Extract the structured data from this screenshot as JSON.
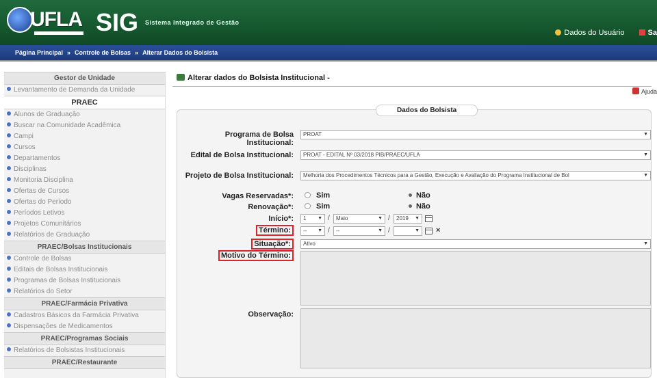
{
  "header": {
    "logo_text": "UFLA",
    "app_name": "SIG",
    "app_subtitle": "Sistema Integrado de Gestão",
    "user_link": "Dados do Usuário",
    "exit_link": "Sa"
  },
  "breadcrumb": [
    "Página Principal",
    "»",
    "Controle de Bolsas",
    "»",
    "Alterar Dados do Bolsista"
  ],
  "sidebar": {
    "sections": [
      {
        "title": "Gestor de Unidade",
        "big": false,
        "items": [
          "Levantamento de Demanda da Unidade"
        ]
      },
      {
        "title": "PRAEC",
        "big": true,
        "items": [
          "Alunos de Graduação",
          "Buscar na Comunidade Acadêmica",
          "Campi",
          "Cursos",
          "Departamentos",
          "Disciplinas",
          "Monitoria Disciplina",
          "Ofertas de Cursos",
          "Ofertas do Período",
          "Períodos Letivos",
          "Projetos Comunitários",
          "Relatórios de Graduação"
        ]
      },
      {
        "title": "PRAEC/Bolsas Institucionais",
        "big": false,
        "items": [
          "Controle de Bolsas",
          "Editais de Bolsas Institucionais",
          "Programas de Bolsas Institucionais",
          "Relatórios do Setor"
        ]
      },
      {
        "title": "PRAEC/Farmácia Privativa",
        "big": false,
        "items": [
          "Cadastros Básicos da Farmácia Privativa",
          "Dispensações de Medicamentos"
        ]
      },
      {
        "title": "PRAEC/Programas Sociais",
        "big": false,
        "items": [
          "Relatórios de Bolsistas Institucionais"
        ]
      },
      {
        "title": "PRAEC/Restaurante",
        "big": false,
        "items": []
      }
    ]
  },
  "main": {
    "title": "Alterar dados do Bolsista Institucional -",
    "help": "Ajuda",
    "fieldset": "Dados do Bolsista",
    "labels": {
      "programa": "Programa de Bolsa Institucional:",
      "edital": "Edital de Bolsa Institucional:",
      "projeto": "Projeto de Bolsa Institucional:",
      "vagas": "Vagas Reservadas*:",
      "renovacao": "Renovação*:",
      "inicio": "Início*:",
      "termino": "Término:",
      "situacao": "Situação*:",
      "motivo": "Motivo do Término:",
      "observacao": "Observação:"
    },
    "values": {
      "programa": "PROAT",
      "edital": "PROAT - EDITAL Nº 03/2018 PIB/PRAEC/UFLA",
      "projeto": "Melhoria dos Procedimentos Técnicos para a Gestão, Execução e Avaliação do Programa Institucional de Bol",
      "sim": "Sim",
      "nao": "Não",
      "inicio_dia": "1",
      "inicio_mes": "Maio",
      "inicio_ano": "2019",
      "termino_dia": "--",
      "termino_mes": "--",
      "termino_ano": "",
      "situacao": "Ativo"
    }
  }
}
